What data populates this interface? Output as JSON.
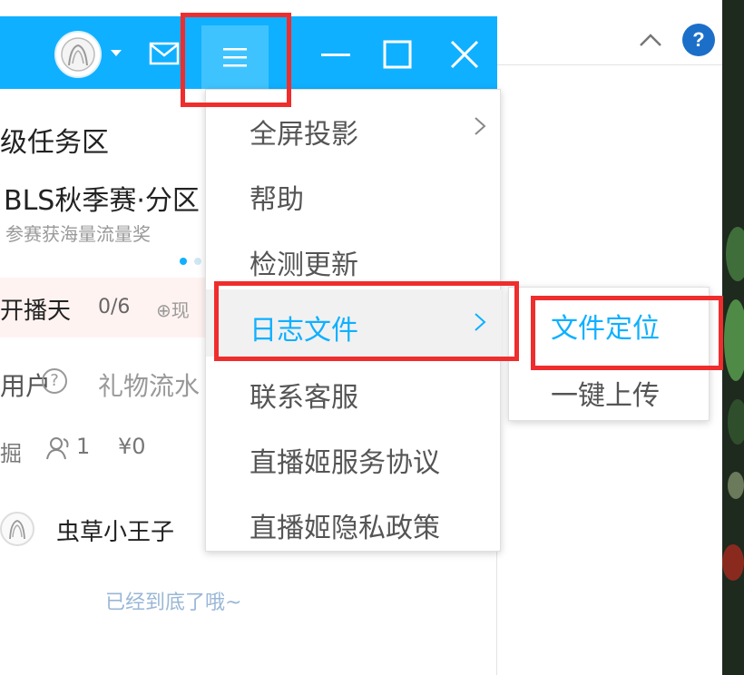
{
  "titlebar": {
    "bg_color": "#0fb0ff",
    "icons": [
      "avatar-icon",
      "caret-down-icon",
      "mail-icon",
      "hamburger-menu-icon",
      "minimize-icon",
      "maximize-icon",
      "close-icon"
    ]
  },
  "background_app": {
    "icons": [
      "chevron-up-icon",
      "help-icon"
    ],
    "help_label": "?"
  },
  "panel": {
    "section_title": "级任务区",
    "event_title": "BLS秋季赛·分区",
    "event_subtitle": "参赛获海量流量奖",
    "task_label": "开播天",
    "task_count": "0/6",
    "task_extra": "⊕现",
    "tab_user": "用户",
    "tab_user_help": "?",
    "tab_gift": "礼物流水",
    "stat_label": "掘",
    "stat_people": "1",
    "stat_money": "¥0",
    "list_user_name": "虫草小王子",
    "list_end_text": "已经到底了哦~"
  },
  "menu": {
    "items": [
      {
        "label": "全屏投影",
        "has_submenu": true
      },
      {
        "label": "帮助",
        "has_submenu": false
      },
      {
        "label": "检测更新",
        "has_submenu": false
      },
      {
        "label": "日志文件",
        "has_submenu": true,
        "active": true
      },
      {
        "label": "联系客服",
        "has_submenu": false
      },
      {
        "label": "直播姬服务协议",
        "has_submenu": false
      },
      {
        "label": "直播姬隐私政策",
        "has_submenu": false
      }
    ]
  },
  "submenu": {
    "items": [
      {
        "label": "文件定位",
        "active": true
      },
      {
        "label": "一键上传",
        "active": false
      }
    ]
  },
  "colors": {
    "accent": "#0fb0ff",
    "highlight_box": "#ef2d2d",
    "help_blue": "#1b6fc8"
  }
}
